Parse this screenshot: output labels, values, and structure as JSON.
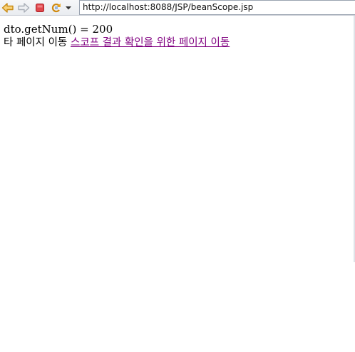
{
  "browser": {
    "url": "http://localhost:8088/JSP/beanScope.jsp",
    "icons": {
      "back": "back-arrow-icon",
      "forward": "forward-arrow-icon",
      "stop": "stop-icon",
      "refresh": "refresh-icon",
      "dropdown": "chevron-down-icon"
    },
    "colors": {
      "back_arrow": "#e0a021",
      "forward_arrow": "#b9bec6",
      "stop": "#d9343a",
      "refresh": "#e0a021"
    }
  },
  "page": {
    "result_line": "dto.getNum() = 200",
    "nav_prefix": "타 페이지 이동",
    "nav_link": "스코프 결과 확인을 위한 페이지 이동",
    "link_color": "#800080"
  }
}
